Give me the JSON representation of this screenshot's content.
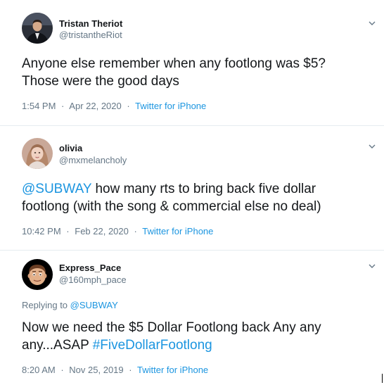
{
  "colors": {
    "text": "#14171a",
    "secondary": "#657786",
    "link": "#1b95e0",
    "divider": "#e6ecf0"
  },
  "tweets": [
    {
      "avatar_icon": "person-in-suit-avatar",
      "display_name": "Tristan Theriot",
      "handle": "@tristantheRiot",
      "text_line1": "Anyone else remember when any footlong was $5?",
      "text_line2": "Those were the good days",
      "time": "1:54 PM",
      "date": "Apr 22, 2020",
      "source": "Twitter for iPhone"
    },
    {
      "avatar_icon": "woman-avatar",
      "display_name": "olivia",
      "handle": "@mxmelancholy",
      "mention": "@SUBWAY",
      "text_line1_rest": " how many rts to bring back five dollar",
      "text_line2": "footlong (with the song & commercial else no deal)",
      "time": "10:42 PM",
      "date": "Feb 22, 2020",
      "source": "Twitter for iPhone"
    },
    {
      "avatar_icon": "memoji-avatar",
      "display_name": "Express_Pace",
      "handle": "@160mph_pace",
      "reply_prefix": "Replying to ",
      "reply_to": "@SUBWAY",
      "text_line1": "Now we need the $5 Dollar Footlong back Any any",
      "text_line2_start": "any...ASAP ",
      "hashtag": "#FiveDollarFootlong",
      "time": "8:20 AM",
      "date": "Nov 25, 2019",
      "source": "Twitter for iPhone"
    }
  ],
  "meta_separator": "·"
}
